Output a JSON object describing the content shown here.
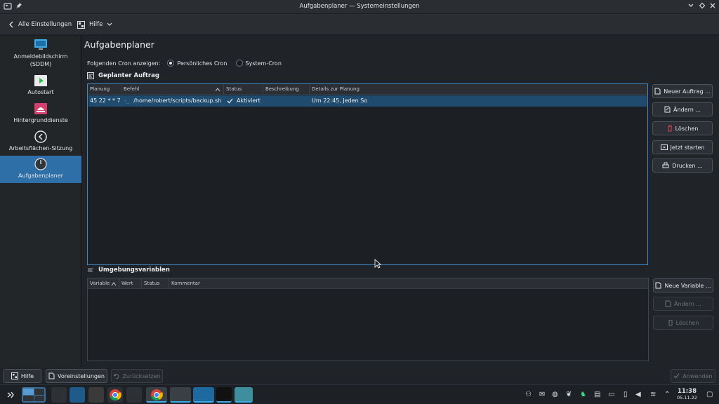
{
  "window": {
    "title": "Aufgabenplaner — Systemeinstellungen"
  },
  "header": {
    "back_label": "Alle Einstellungen",
    "help_label": "Hilfe"
  },
  "sidebar": {
    "items": [
      {
        "label": "Anmeldebildschirm\n(SDDM)",
        "icon": "monitor-icon"
      },
      {
        "label": "Autostart",
        "icon": "autostart-icon"
      },
      {
        "label": "Hintergrunddienste",
        "icon": "services-icon"
      },
      {
        "label": "Arbeitsflächen-Sitzung",
        "icon": "session-icon"
      },
      {
        "label": "Aufgabenplaner",
        "icon": "clock-icon",
        "active": true
      }
    ]
  },
  "main": {
    "title": "Aufgabenplaner",
    "cron_label": "Folgenden Cron anzeigen:",
    "cron_options": [
      "Persönliches Cron",
      "System-Cron"
    ],
    "cron_selected": "Persönliches Cron",
    "tasks_section": "Geplanter Auftrag",
    "tasks_columns": [
      "Planung",
      "Befehl",
      "Status",
      "Beschreibung",
      "Details zur Planung"
    ],
    "tasks_rows": [
      {
        "planung": "45 22 * * 7",
        "befehl": "/home/robert/scripts/backup.sh",
        "status": "Aktiviert",
        "beschreibung": "",
        "details": "Um 22:45, Jeden So"
      }
    ],
    "task_buttons": [
      "Neuer Auftrag ...",
      "Ändern ...",
      "Löschen",
      "Jetzt starten",
      "Drucken ..."
    ],
    "env_section": "Umgebungsvariablen",
    "env_columns": [
      "Variable",
      "Wert",
      "Status",
      "Kommentar"
    ],
    "env_buttons": [
      "Neue Variable ...",
      "Ändern ...",
      "Löschen"
    ]
  },
  "footer": {
    "help": "Hilfe",
    "defaults": "Voreinstellungen",
    "reset": "Zurücksetzen",
    "apply": "Anwenden"
  },
  "taskbar": {
    "time": "11:38",
    "date": "05.11.22"
  },
  "colors": {
    "accent": "#2d6fa6",
    "selection": "#1f4b6e",
    "focus_border": "#3d87c7"
  }
}
